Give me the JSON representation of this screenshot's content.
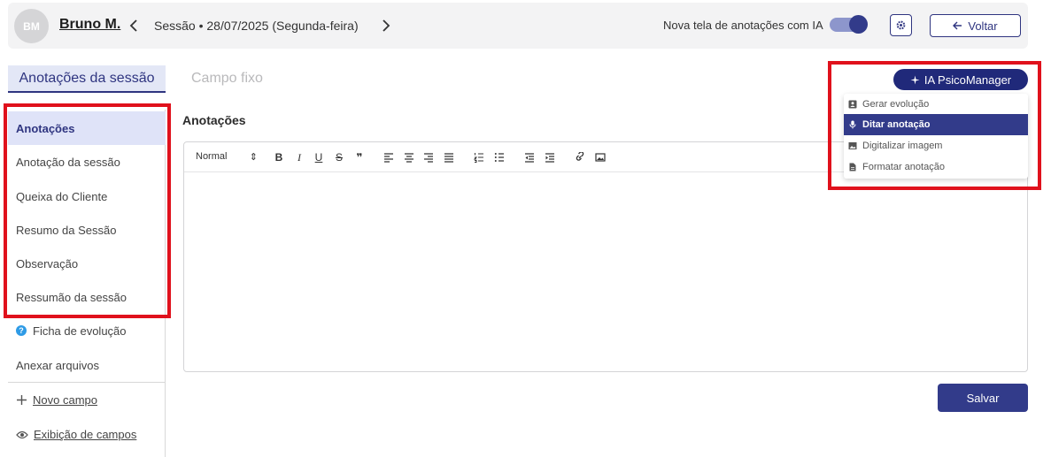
{
  "header": {
    "avatar_initials": "BM",
    "patient_name": "Bruno M.",
    "session_text": "Sessão • 28/07/2025 (Segunda-feira)",
    "toggle_label": "Nova tela de anotações com IA",
    "toggle_on": true,
    "back_label": "Voltar"
  },
  "sidebar": {
    "title": "Anotações da sessão",
    "items": [
      {
        "label": "Anotações",
        "active": true
      },
      {
        "label": "Anotação da sessão"
      },
      {
        "label": "Queixa do Cliente"
      },
      {
        "label": "Resumo da Sessão"
      },
      {
        "label": "Observação"
      },
      {
        "label": "Ressumão da sessão"
      },
      {
        "label": "Ficha de evolução",
        "icon": "question-icon"
      },
      {
        "label": "Anexar arquivos"
      }
    ],
    "new_field": "Novo campo",
    "display_fields": "Exibição de campos"
  },
  "main": {
    "campo_fixo": "Campo fixo",
    "section_label": "Anotações",
    "toolbar": {
      "format_select": "Normal",
      "format_arrow": "⇕",
      "bold": "B",
      "italic": "I",
      "underline": "U",
      "strike": "S",
      "quote": "❞"
    },
    "save_label": "Salvar"
  },
  "ia": {
    "button_label": "IA PsicoManager",
    "menu": [
      {
        "label": "Gerar evolução",
        "icon": "user-card-icon"
      },
      {
        "label": "Ditar anotação",
        "icon": "microphone-icon",
        "active": true
      },
      {
        "label": "Digitalizar imagem",
        "icon": "image-icon"
      },
      {
        "label": "Formatar anotação",
        "icon": "document-icon"
      }
    ]
  },
  "colors": {
    "primary": "#323b8a",
    "annotation_red": "#e0111c",
    "sidebar_active_bg": "#dfe3f8"
  }
}
